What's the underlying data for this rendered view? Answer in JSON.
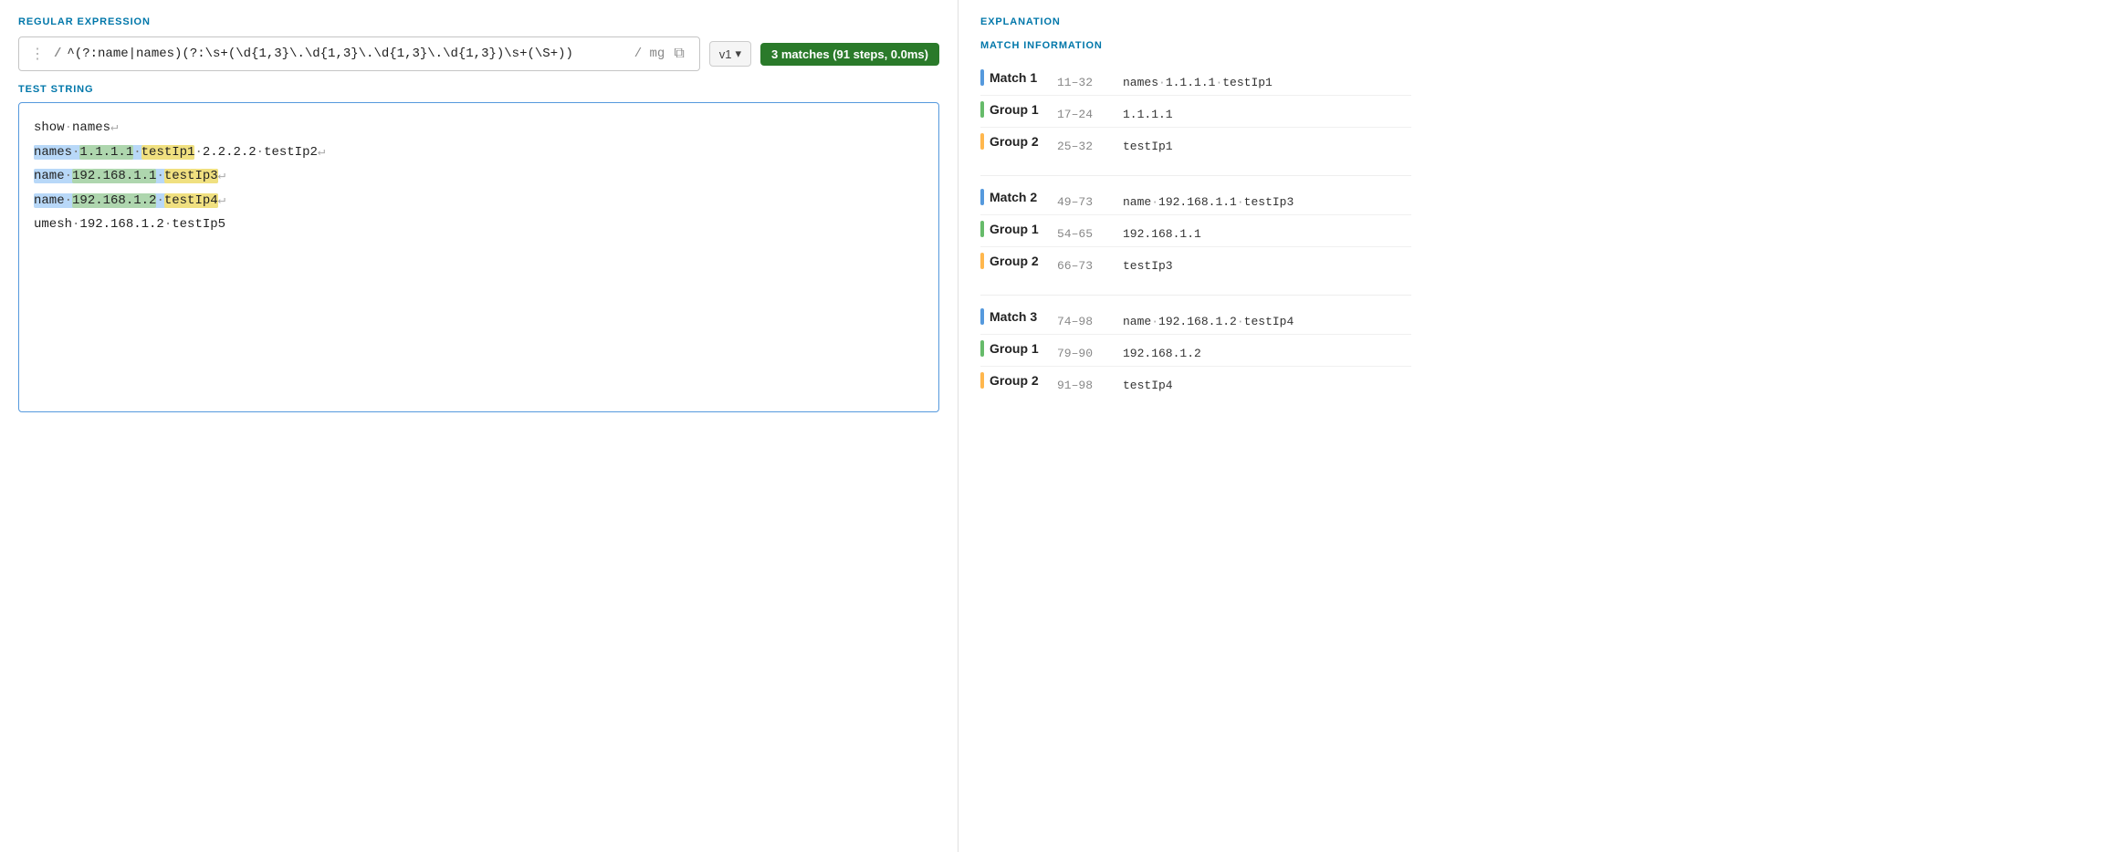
{
  "header": {
    "regex_section_label": "REGULAR EXPRESSION",
    "test_section_label": "TEST STRING",
    "explanation_label": "EXPLANATION",
    "match_info_label": "MATCH INFORMATION"
  },
  "regex": {
    "delimiter_open": "/",
    "delimiter_close": "/",
    "pattern": "^(?:name|names)(?:\\s+(\\d{1,3}\\.\\d{1,3}\\.\\d{1,3}\\.\\d{1,3})\\s+(\\S+))",
    "flags": "mg",
    "version": "v1",
    "version_arrow": "▾",
    "match_summary": "3 matches (91 steps, 0.0ms)",
    "copy_icon": "⧉",
    "drag_icon": "⋮"
  },
  "test_string": {
    "lines": [
      {
        "text": "show·names↵",
        "plain": true
      },
      {
        "text": "names·1.1.1.1·testIp1·2.2.2.2·testIp2↵",
        "match": 1
      },
      {
        "text": "name·192.168.1.1·testIp3↵",
        "match": 2
      },
      {
        "text": "name·192.168.1.2·testIp4↵",
        "match": 3
      },
      {
        "text": "umesh·192.168.1.2·testIp5",
        "plain": true
      }
    ]
  },
  "match_info": {
    "matches": [
      {
        "label": "Match 1",
        "range": "11–32",
        "value": "names·1.1.1.1·testIp1",
        "groups": [
          {
            "label": "Group 1",
            "range": "17–24",
            "value": "1.1.1.1"
          },
          {
            "label": "Group 2",
            "range": "25–32",
            "value": "testIp1"
          }
        ]
      },
      {
        "label": "Match 2",
        "range": "49–73",
        "value": "name·192.168.1.1·testIp3",
        "groups": [
          {
            "label": "Group 1",
            "range": "54–65",
            "value": "192.168.1.1"
          },
          {
            "label": "Group 2",
            "range": "66–73",
            "value": "testIp3"
          }
        ]
      },
      {
        "label": "Match 3",
        "range": "74–98",
        "value": "name·192.168.1.2·testIp4",
        "groups": [
          {
            "label": "Group 1",
            "range": "79–90",
            "value": "192.168.1.2"
          },
          {
            "label": "Group 2",
            "range": "91–98",
            "value": "testIp4"
          }
        ]
      }
    ]
  }
}
